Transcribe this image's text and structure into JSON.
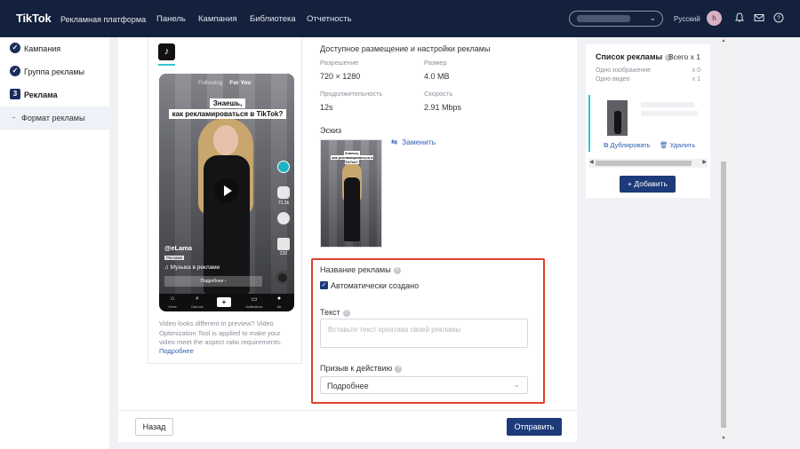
{
  "topbar": {
    "logo": "TikTok",
    "logo_sub": "Рекламная платформа",
    "nav": [
      "Панель",
      "Кампания",
      "Библиотека",
      "Отчетность"
    ],
    "language": "Русский",
    "avatar_letter": "h"
  },
  "sidebar": {
    "steps": [
      {
        "label": "Кампания",
        "icon": "check-icon"
      },
      {
        "label": "Группа рекламы",
        "icon": "check-icon"
      },
      {
        "label": "Реклама",
        "number": "3"
      }
    ],
    "sub_item": "Формат рекламы"
  },
  "preview": {
    "feed_following": "Following",
    "feed_for_you": "For You",
    "caption_line1": "Знаешь,",
    "caption_line2": "как рекламироваться в TikTok?",
    "likes": "71.1k",
    "comments": "232",
    "username": "@eLama",
    "sponsored": "Реклама",
    "music": "♫ Музыка в рекламе",
    "cta": "Подробнее ›",
    "nav": [
      "Home",
      "Discover",
      "",
      "Notifications",
      "Me"
    ],
    "note": "Video looks different in preview? Video Optimization Tool is applied to make your video meet the aspect ratio requirements.",
    "note_link": "Подробнее"
  },
  "details": {
    "section_title": "Доступное размещение и настройки рекламы",
    "resolution_label": "Разрешение",
    "resolution_value": "720 × 1280",
    "size_label": "Размер",
    "size_value": "4.0 MB",
    "duration_label": "Продолжительность",
    "duration_value": "12s",
    "speed_label": "Скорость",
    "speed_value": "2.91 Mbps",
    "thumbnail_label": "Эскиз",
    "replace_label": "Заменить",
    "thumb_caption1": "Знаешь,",
    "thumb_caption2": "как рекламироваться в TikTok?"
  },
  "form": {
    "ad_name_label": "Название рекламы",
    "auto_created_label": "Автоматически создано",
    "text_label": "Текст",
    "text_placeholder": "Вставьте текст креатива своей рекламы",
    "cta_label": "Призыв к действию",
    "cta_value": "Подробнее"
  },
  "footer": {
    "back_label": "Назад",
    "send_label": "Отправить"
  },
  "ad_list": {
    "title": "Список рекламы",
    "total": "Всего x 1",
    "single_image_label": "Одно изображение",
    "single_image_count": "x 0",
    "single_video_label": "Одно видео",
    "single_video_count": "x 1",
    "duplicate_label": "Дублировать",
    "delete_label": "Удалить",
    "add_label": "+ Добавить"
  },
  "colors": {
    "topbar": "#14213d",
    "primary": "#1d3a7a",
    "link": "#2f5fb3",
    "highlight": "#e0402c",
    "accent": "#32c5d4"
  }
}
